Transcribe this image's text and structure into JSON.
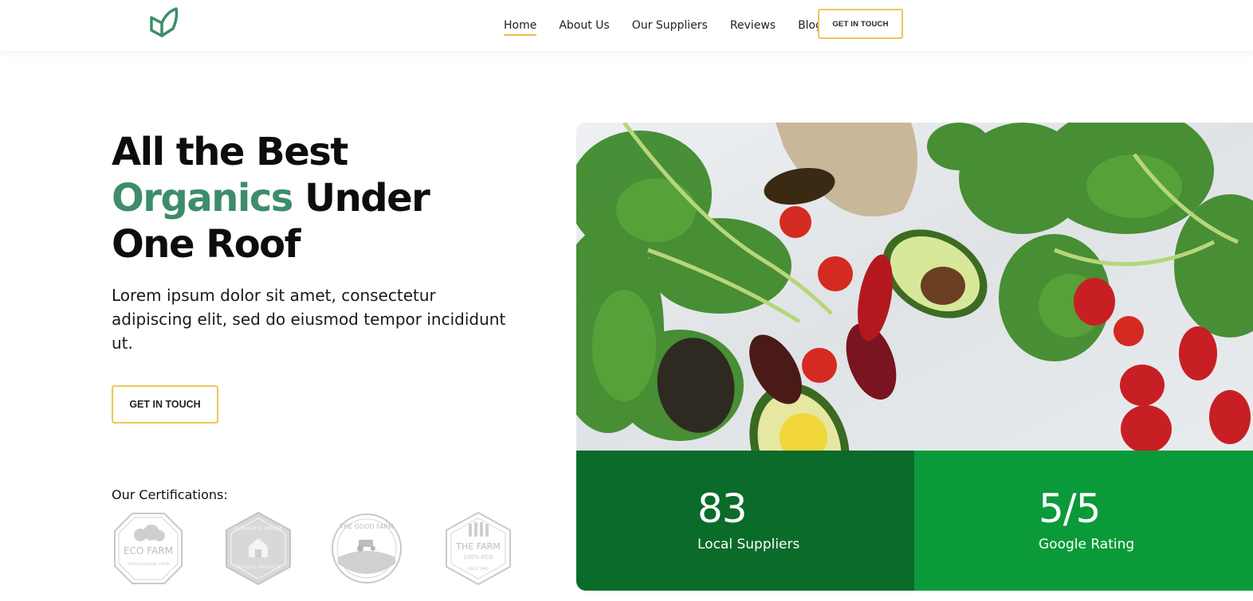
{
  "nav": {
    "items": [
      {
        "label": "Home",
        "active": true
      },
      {
        "label": "About Us",
        "active": false
      },
      {
        "label": "Our Suppliers",
        "active": false
      },
      {
        "label": "Reviews",
        "active": false
      },
      {
        "label": "Blog",
        "active": false
      }
    ],
    "cta_label": "GET IN TOUCH"
  },
  "hero": {
    "title_line1": "All the Best",
    "title_accent": "Organics",
    "title_rest": " Under",
    "title_line3": "One Roof",
    "description": "Lorem ipsum dolor sit amet, consectetur adipiscing elit, sed do eiusmod tempor incididunt ut.",
    "cta_label": "GET IN TOUCH"
  },
  "certifications": {
    "title": "Our Certifications:",
    "badges": [
      {
        "name": "ECO FARM",
        "sub": "100% ECOLOGIC FOOD"
      },
      {
        "name": "FARMER'S HOUSE",
        "sub": "ECOLOGIC PRODUCTS"
      },
      {
        "name": "THE GOOD FARM",
        "sub": ""
      },
      {
        "name": "THE FARM",
        "sub": "100% ECO",
        "since": "SINCE 1995"
      }
    ]
  },
  "stats": [
    {
      "value": "83",
      "label": "Local Suppliers"
    },
    {
      "value": "5/5",
      "label": "Google Rating"
    }
  ],
  "colors": {
    "accent_green": "#3d8d6a",
    "button_border": "#f0c55a",
    "stat_dark": "#0a6b2a",
    "stat_light": "#0a9a3a"
  },
  "icons": {
    "logo": "leaf-logo-icon"
  }
}
